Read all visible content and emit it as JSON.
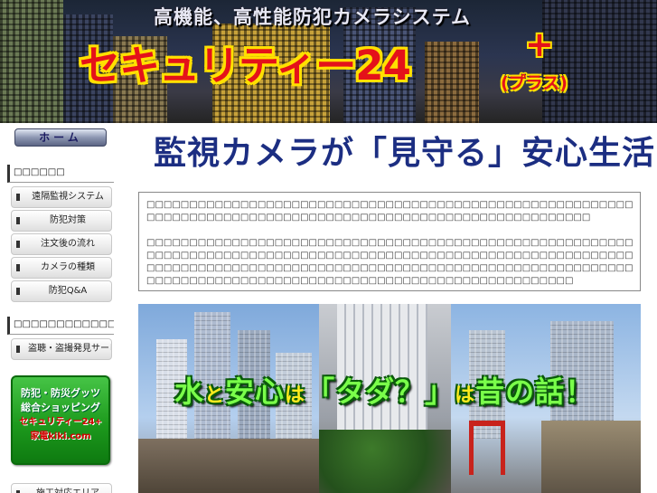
{
  "header": {
    "subtitle": "高機能、高性能防犯カメラシステム",
    "brand_title": "セキュリティー24",
    "brand_plus_mark": "+",
    "brand_plus_text": "(プラス)"
  },
  "nav": {
    "home_label": "ホーム",
    "section1_heading": "□□□□□□",
    "section1_items": [
      {
        "label": "遠隔監視システム"
      },
      {
        "label": "防犯対策"
      },
      {
        "label": "注文後の流れ"
      },
      {
        "label": "カメラの種類"
      },
      {
        "label": "防犯Q&A"
      }
    ],
    "section2_heading": "□□□□□□□□□□□□",
    "section2_items": [
      {
        "label": "盗聴・盗撮発見サービス"
      }
    ],
    "shop_banner": {
      "line1": "防犯・防災グッツ",
      "line2": "総合ショッピング",
      "line3": "セキュリティー24+",
      "line4": "家電kiki.com"
    },
    "partial_item_label": "施工対応エリア"
  },
  "main": {
    "title": "監視カメラが「見守る」安心生活！",
    "intro_lines": [
      "□□□□□□□□□□□□□□□□□□□□□□□□□□□□□□□□□□□□□□□□□□□□□□□□□□□□□□□□□□□□□□□□□□",
      "□□□□□□□□□□□□□□□□□□□□□□□□□□□□□□□□□□□□□□□□□□□□□□□□□□□□",
      "",
      "□□□□□□□□□□□□□□□□□□□□□□□□□□□□□□□□□□□□□□□□□□□□□□□□□□□□□□□□□□□□□□□□□",
      "□□□□□□□□□□□□□□□□□□□□□□□□□□□□□□□□□□□□□□□□□□□□□□□□□□□□□□□□□□□□□□□□□",
      "□□□□□□□□□□□□□□□□□□□□□□□□□□□□□□□□□□□□□□□□□□□□□□□□□□□□□□□□□",
      "□□□□□□□□□□□□□□□□□□□□□□□□□□□□□□□□□□□□□□□□□□□□□□□□□□"
    ],
    "photo_caption": {
      "w1": "水",
      "p1": "と",
      "w2": "安心",
      "p2": "は",
      "w3": "「タダ？」",
      "p3": "は",
      "w4": "昔の話！"
    }
  }
}
